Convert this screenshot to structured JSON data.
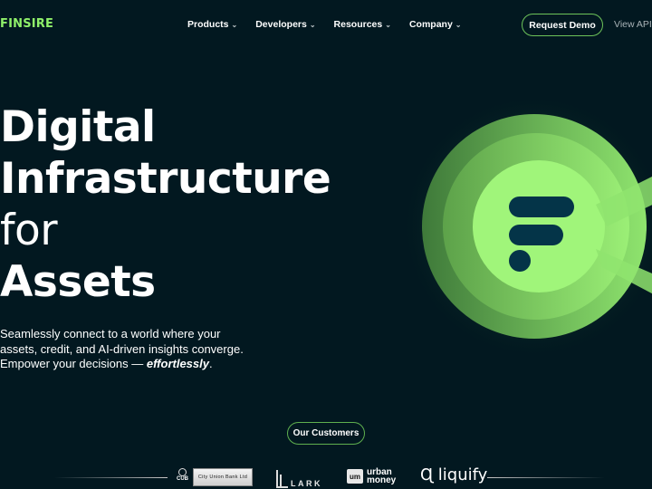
{
  "nav": {
    "logo": "FINSIRE",
    "menu": [
      {
        "label": "Products",
        "chevron": "⌄"
      },
      {
        "label": "Developers",
        "chevron": "⌄"
      },
      {
        "label": "Resources",
        "chevron": "⌄"
      },
      {
        "label": "Company",
        "chevron": "⌄"
      }
    ],
    "request_demo": "Request Demo",
    "view_apis": "View APIs"
  },
  "hero": {
    "title_line1": "Digital",
    "title_line2": "Infrastructure",
    "title_line3": "for",
    "title_line4": "Assets",
    "subtitle_line1": "Seamlessly connect to a world where your",
    "subtitle_line2": "assets, credit, and AI-driven insights converge.",
    "subtitle_line3_prefix": "Empower your decisions — ",
    "subtitle_emphasis": "effortlessly",
    "subtitle_suffix": "."
  },
  "graphic": {
    "icon": "finsire-f-logo-icon",
    "colors": {
      "accent": "#a0f57a",
      "ring2": "#7fd862",
      "ring3": "#4e9a44",
      "mark": "#043448",
      "background": "#021820"
    }
  },
  "customers": {
    "button_label": "Our Customers",
    "logos": [
      {
        "name": "City Union Bank Ltd",
        "short": "CUB",
        "text": "City Union Bank Ltd"
      },
      {
        "name": "Lark",
        "text": "LARK"
      },
      {
        "name": "Urban Money",
        "badge": "um",
        "text_line1": "urban",
        "text_line2": "money"
      },
      {
        "name": "Liquify",
        "text": "liquify",
        "glyph": "Ɋ"
      }
    ]
  }
}
